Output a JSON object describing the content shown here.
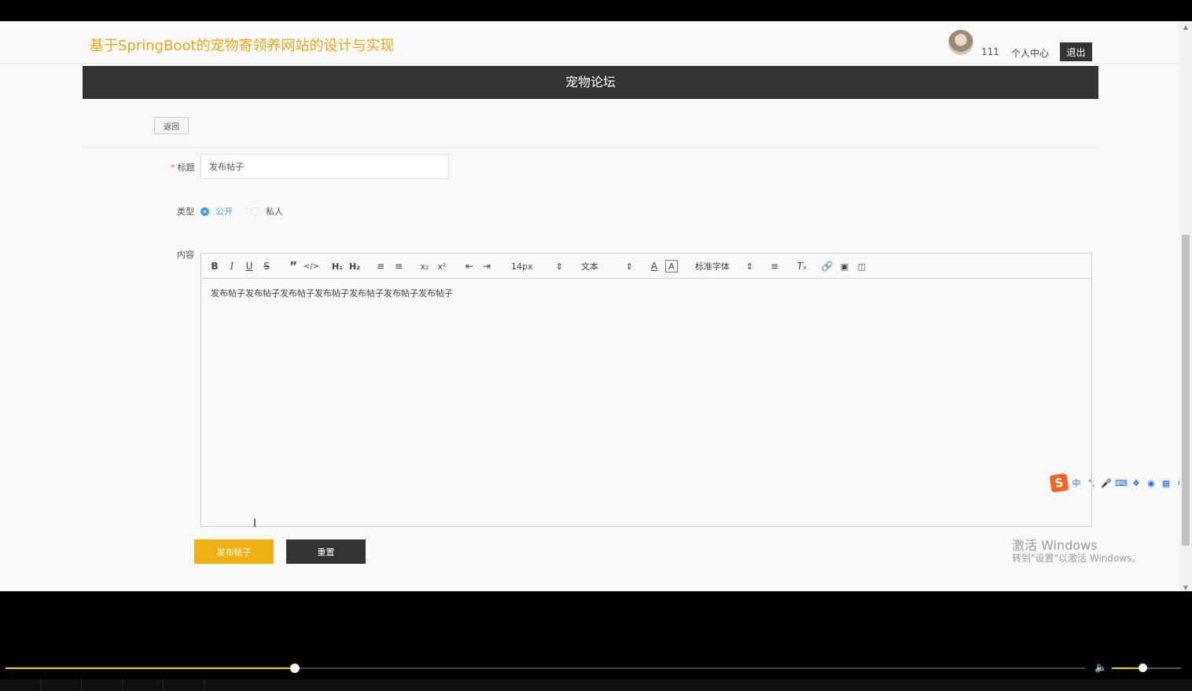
{
  "header": {
    "site_title": "基于SpringBoot的宠物寄领养网站的设计与实现",
    "user_name": "111",
    "profile_link": "个人中心",
    "logout_label": "退出"
  },
  "banner": {
    "title": "宠物论坛"
  },
  "form": {
    "back_label": "返回",
    "title_label": "标题",
    "title_required_mark": "*",
    "title_value": "发布帖子",
    "type_label": "类型",
    "type_options": [
      "公开",
      "私人"
    ],
    "type_selected": "公开",
    "content_label": "内容",
    "content_value": "发布帖子发布帖子发布帖子发布帖子发布帖子发布帖子发布帖子",
    "submit_label": "发布帖子",
    "reset_label": "重置"
  },
  "editor_toolbar": {
    "buttons": [
      "bold-icon",
      "italic-icon",
      "underline-icon",
      "strike-icon",
      "blockquote-icon",
      "code-block-icon",
      "h1-icon",
      "h2-icon",
      "ordered-list-icon",
      "bullet-list-icon",
      "subscript-icon",
      "superscript-icon",
      "outdent-icon",
      "indent-icon",
      "font-color-icon",
      "background-color-icon",
      "align-icon",
      "clean-format-icon",
      "link-icon",
      "image-icon",
      "video-icon"
    ],
    "size_select": "14px",
    "header_select": "文本",
    "font_select": "标准字体"
  },
  "watermark": {
    "line1": "激活 Windows",
    "line2": "转到\"设置\"以激活 Windows。"
  },
  "ime": {
    "mode": "中",
    "icons": [
      "punctuation-icon",
      "microphone-icon",
      "keyboard-icon",
      "skin-icon",
      "game-icon",
      "toolbox-icon",
      "settings-icon"
    ]
  },
  "player": {
    "progress": 0.268,
    "volume": 0.44
  },
  "colors": {
    "accent": "#edb111",
    "title": "#e6a817",
    "dark": "#333333",
    "radio": "#409eff"
  }
}
